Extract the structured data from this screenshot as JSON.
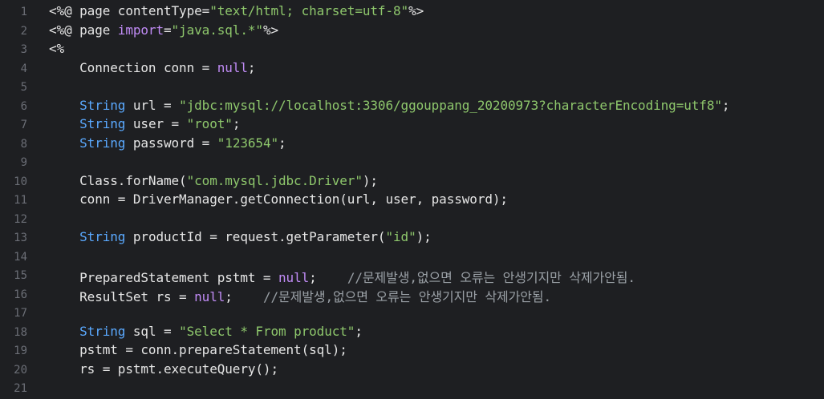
{
  "editor": {
    "colors": {
      "background": "#1e1f22",
      "line_number": "#6b6e76",
      "plain": "#e6e6e6",
      "keyword": "#c08bf5",
      "type": "#5aa9ff",
      "string": "#8ec76c",
      "comment": "#9aa0a6"
    },
    "lines": [
      {
        "num": "1",
        "tokens": [
          {
            "t": "<%@ page contentType=",
            "k": "plain"
          },
          {
            "t": "\"text/html; charset=utf-8\"",
            "k": "str"
          },
          {
            "t": "%>",
            "k": "plain"
          }
        ]
      },
      {
        "num": "2",
        "tokens": [
          {
            "t": "<%@ page ",
            "k": "plain"
          },
          {
            "t": "import",
            "k": "kw"
          },
          {
            "t": "=",
            "k": "plain"
          },
          {
            "t": "\"java.sql.*\"",
            "k": "str"
          },
          {
            "t": "%>",
            "k": "plain"
          }
        ]
      },
      {
        "num": "3",
        "tokens": [
          {
            "t": "<%",
            "k": "plain"
          }
        ]
      },
      {
        "num": "4",
        "tokens": [
          {
            "t": "    Connection conn = ",
            "k": "plain"
          },
          {
            "t": "null",
            "k": "kw"
          },
          {
            "t": ";",
            "k": "plain"
          }
        ]
      },
      {
        "num": "5",
        "tokens": []
      },
      {
        "num": "6",
        "tokens": [
          {
            "t": "    ",
            "k": "plain"
          },
          {
            "t": "String",
            "k": "ty"
          },
          {
            "t": " url = ",
            "k": "plain"
          },
          {
            "t": "\"jdbc:mysql://localhost:3306/ggouppang_20200973?characterEncoding=utf8\"",
            "k": "str"
          },
          {
            "t": ";",
            "k": "plain"
          }
        ]
      },
      {
        "num": "7",
        "tokens": [
          {
            "t": "    ",
            "k": "plain"
          },
          {
            "t": "String",
            "k": "ty"
          },
          {
            "t": " user = ",
            "k": "plain"
          },
          {
            "t": "\"root\"",
            "k": "str"
          },
          {
            "t": ";",
            "k": "plain"
          }
        ]
      },
      {
        "num": "8",
        "tokens": [
          {
            "t": "    ",
            "k": "plain"
          },
          {
            "t": "String",
            "k": "ty"
          },
          {
            "t": " password = ",
            "k": "plain"
          },
          {
            "t": "\"123654\"",
            "k": "str"
          },
          {
            "t": ";",
            "k": "plain"
          }
        ]
      },
      {
        "num": "9",
        "tokens": []
      },
      {
        "num": "10",
        "tokens": [
          {
            "t": "    Class.forName(",
            "k": "plain"
          },
          {
            "t": "\"com.mysql.jdbc.Driver\"",
            "k": "str"
          },
          {
            "t": ");",
            "k": "plain"
          }
        ]
      },
      {
        "num": "11",
        "tokens": [
          {
            "t": "    conn = DriverManager.getConnection(url, user, password);",
            "k": "plain"
          }
        ]
      },
      {
        "num": "12",
        "tokens": []
      },
      {
        "num": "13",
        "tokens": [
          {
            "t": "    ",
            "k": "plain"
          },
          {
            "t": "String",
            "k": "ty"
          },
          {
            "t": " productId = request.getParameter(",
            "k": "plain"
          },
          {
            "t": "\"id\"",
            "k": "str"
          },
          {
            "t": ");",
            "k": "plain"
          }
        ]
      },
      {
        "num": "14",
        "tokens": []
      },
      {
        "num": "15",
        "tokens": [
          {
            "t": "    PreparedStatement pstmt = ",
            "k": "plain"
          },
          {
            "t": "null",
            "k": "kw"
          },
          {
            "t": ";    ",
            "k": "plain"
          },
          {
            "t": "//문제발생,없으면 오류는 안생기지만 삭제가안됨.",
            "k": "cm"
          }
        ]
      },
      {
        "num": "16",
        "tokens": [
          {
            "t": "    ResultSet rs = ",
            "k": "plain"
          },
          {
            "t": "null",
            "k": "kw"
          },
          {
            "t": ";    ",
            "k": "plain"
          },
          {
            "t": "//문제발생,없으면 오류는 안생기지만 삭제가안됨.",
            "k": "cm"
          }
        ]
      },
      {
        "num": "17",
        "tokens": []
      },
      {
        "num": "18",
        "tokens": [
          {
            "t": "    ",
            "k": "plain"
          },
          {
            "t": "String",
            "k": "ty"
          },
          {
            "t": " sql = ",
            "k": "plain"
          },
          {
            "t": "\"Select * From product\"",
            "k": "str"
          },
          {
            "t": ";",
            "k": "plain"
          }
        ]
      },
      {
        "num": "19",
        "tokens": [
          {
            "t": "    pstmt = conn.prepareStatement(sql);",
            "k": "plain"
          }
        ]
      },
      {
        "num": "20",
        "tokens": [
          {
            "t": "    rs = pstmt.executeQuery();",
            "k": "plain"
          }
        ]
      },
      {
        "num": "21",
        "tokens": []
      }
    ]
  }
}
